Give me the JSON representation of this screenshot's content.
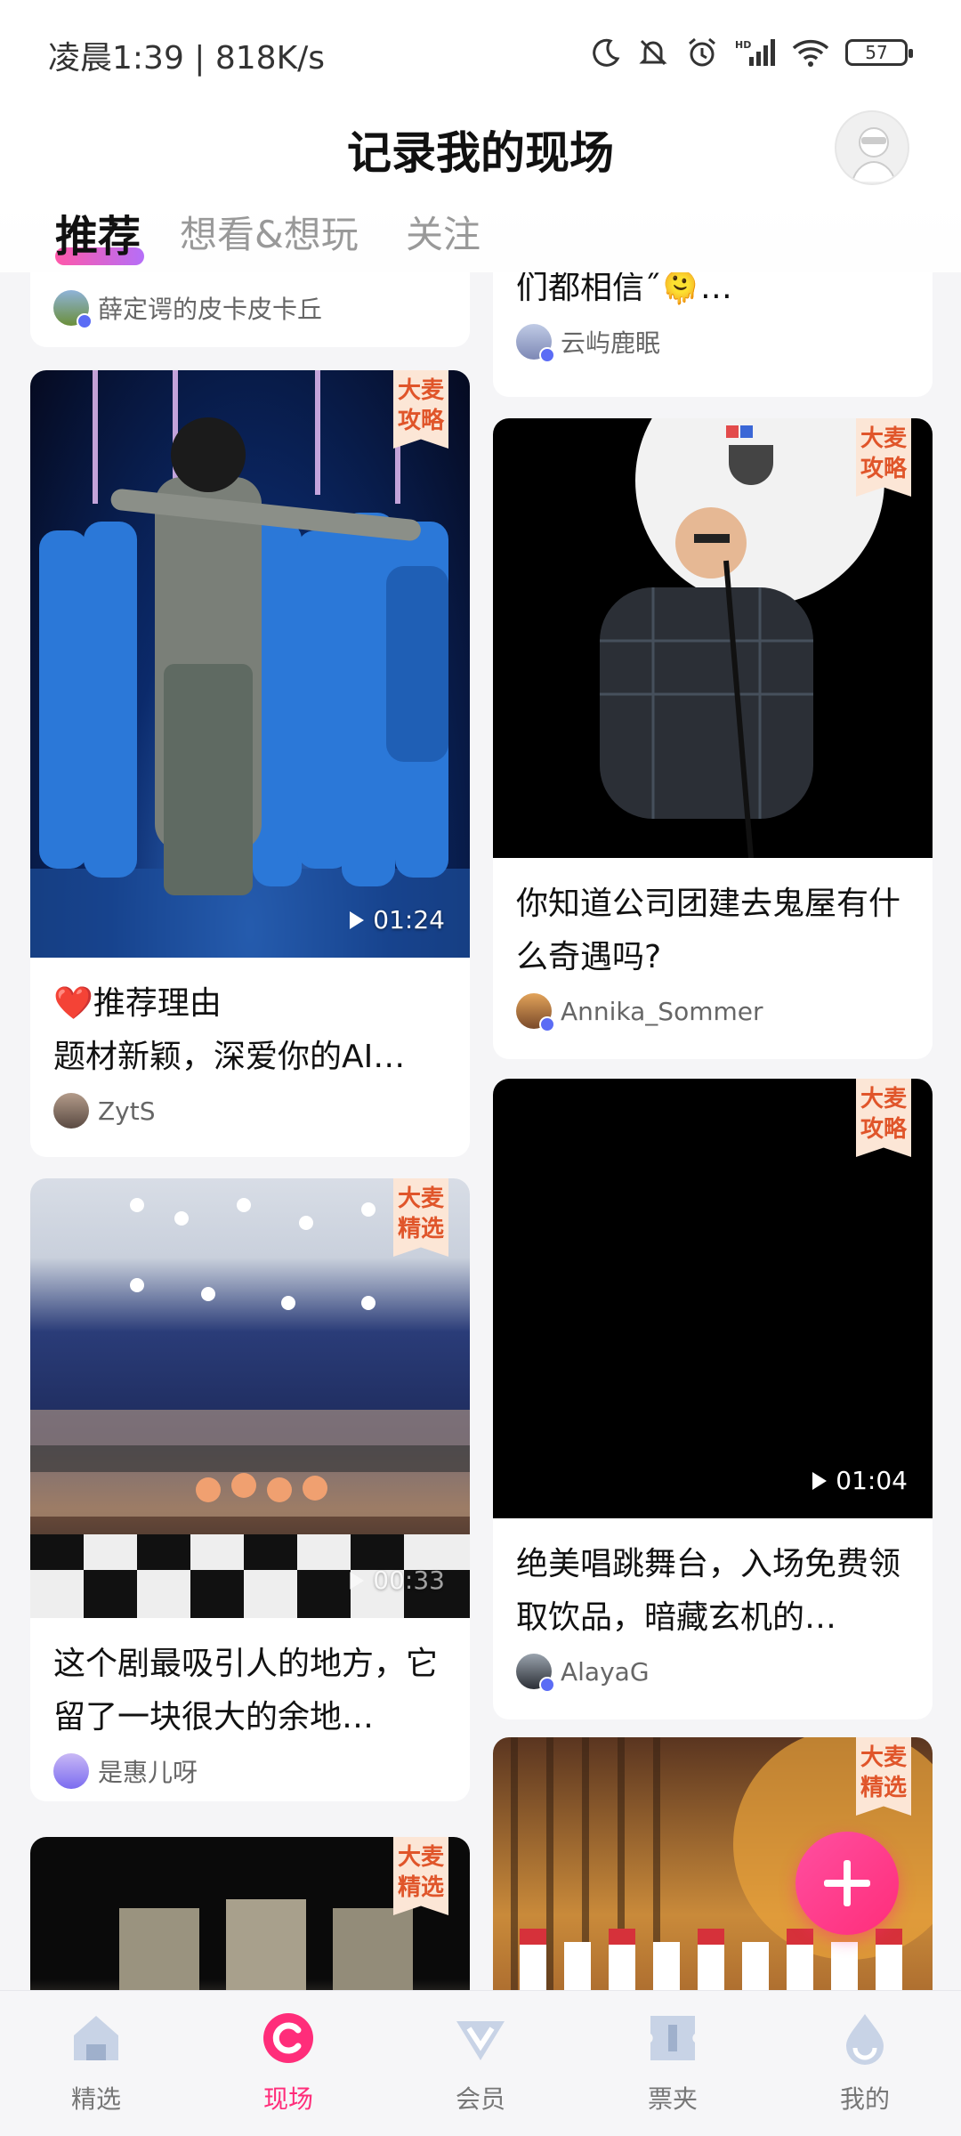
{
  "status_bar": {
    "time": "凌晨1:39 | 818K/s",
    "battery": "57"
  },
  "header": {
    "title": "记录我的现场"
  },
  "tabs": [
    {
      "label": "推荐",
      "active": true
    },
    {
      "label": "想看&想玩",
      "active": false
    },
    {
      "label": "关注",
      "active": false
    }
  ],
  "feed": {
    "left": [
      {
        "author": "薛定谔的皮卡皮卡丘"
      },
      {
        "badge": "大麦\n攻略",
        "duration": "01:24",
        "reason_heading": "❤️推荐理由",
        "reason_text": "题材新颖，深爱你的AI…",
        "author": "ZytS"
      },
      {
        "badge": "大麦\n精选",
        "duration": "00:33",
        "title": "这个剧最吸引人的地方，它留了一块很大的余地…",
        "author": "是惠儿呀"
      },
      {
        "badge": "大麦\n精选"
      }
    ],
    "right": [
      {
        "title": "们都相信˝🫠…",
        "author": "云屿鹿眠"
      },
      {
        "badge": "大麦\n攻略",
        "title": "你知道公司团建去鬼屋有什么奇遇吗?",
        "author": "Annika_Sommer"
      },
      {
        "badge": "大麦\n攻略",
        "duration": "01:04",
        "title": "绝美唱跳舞台，入场免费领取饮品，暗藏玄机的…",
        "author": "AlayaG"
      },
      {
        "badge": "大麦\n精选"
      }
    ]
  },
  "bottom_nav": [
    {
      "label": "精选",
      "icon": "home-icon",
      "active": false
    },
    {
      "label": "现场",
      "icon": "live-icon",
      "active": true
    },
    {
      "label": "会员",
      "icon": "vip-icon",
      "active": false
    },
    {
      "label": "票夹",
      "icon": "ticket-icon",
      "active": false
    },
    {
      "label": "我的",
      "icon": "profile-icon",
      "active": false
    }
  ],
  "colors": {
    "accent": "#ff2d7a",
    "badge_bg": "#fce6d6",
    "badge_text": "#e0552a"
  }
}
